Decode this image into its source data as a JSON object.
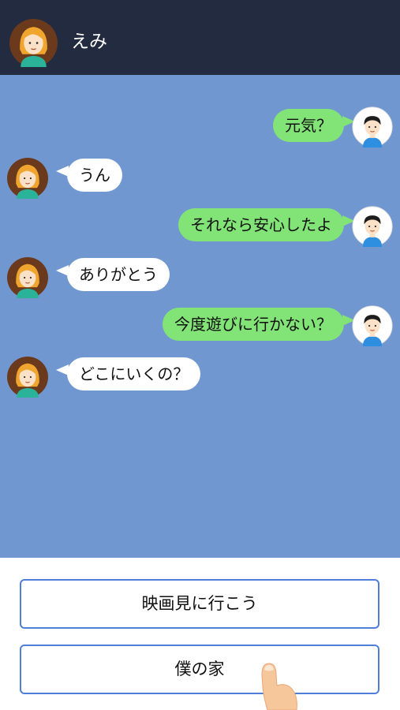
{
  "header": {
    "contact_name": "えみ",
    "avatar_icon": "girl-avatar-icon",
    "background": "#222b3f"
  },
  "chat": {
    "background": "#7197d1",
    "messages": [
      {
        "from": "me",
        "text": "元気？"
      },
      {
        "from": "emi",
        "text": "うん"
      },
      {
        "from": "me",
        "text": "それなら安心したよ"
      },
      {
        "from": "emi",
        "text": "ありがとう"
      },
      {
        "from": "me",
        "text": "今度遊びに行かない？"
      },
      {
        "from": "emi",
        "text": "どこにいくの？"
      }
    ],
    "outgoing_bubble_color": "#82e376",
    "incoming_bubble_color": "#ffffff"
  },
  "choices": {
    "items": [
      {
        "label": "映画見に行こう"
      },
      {
        "label": "僕の家"
      }
    ],
    "border_color": "#4f7fd8"
  },
  "pointer": {
    "icon": "finger-pointer-icon"
  }
}
